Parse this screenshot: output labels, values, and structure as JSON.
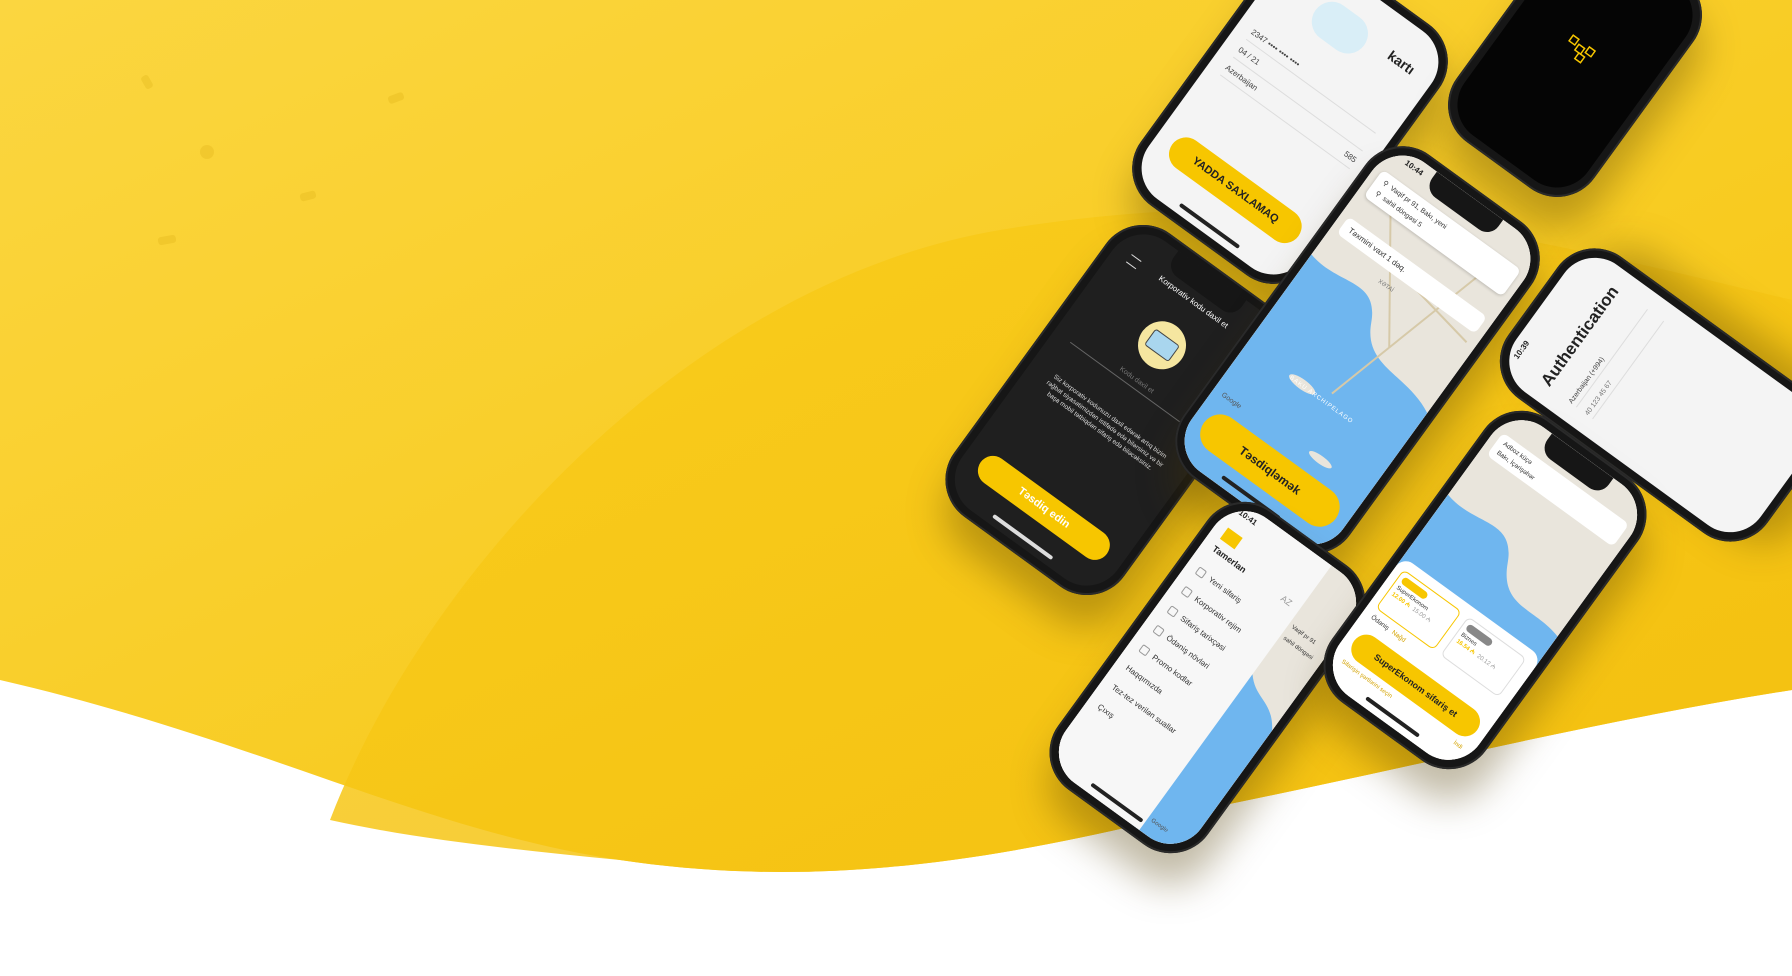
{
  "colors": {
    "brand_yellow": "#f7c600",
    "light_yellow": "#fbd63c",
    "dark_screen": "#1f1f1f",
    "map_water": "#6fb6ef",
    "map_land": "#e9e5dc"
  },
  "card_screen": {
    "title": "kartı",
    "card_number": "2347 •••• •••• ••••",
    "expiry": "04 / 21",
    "country": "Azerbaijan",
    "cvv": "585",
    "button": "YADDA SAXLAMAQ"
  },
  "logo_screen": {
    "icon": "taxi-checker-logo-icon"
  },
  "corporate_screen": {
    "title": "Korporativ kodu daxil et",
    "input_placeholder": "Kodu daxil et",
    "description": "Siz korporativ kodunuzu daxil edərək artıq bizim rəğbət siyasətimizdən istifadə edə bilərsiniz və bir başa mobil tətbiqdən sifariş edə biləcəksiniz.",
    "button": "Təsdiq edin",
    "illustration": "briefcase-icon"
  },
  "map_screen": {
    "status_time": "10:44",
    "from": "Vaqif pr 91, Bakı, yeni",
    "to": "sahil döngəsi 5",
    "eta": "Təxmini vaxt 1 dəq.",
    "map_label_area": "XƏTAİ",
    "map_label_sea": "BAKU ARCHIPELAGO",
    "button": "Təsdiqləmək",
    "google": "Google"
  },
  "auth_screen": {
    "status_time": "10:39",
    "title": "Authentication",
    "country": "Azerbaijan (+994)",
    "phone": "40 123 45 67"
  },
  "menu_screen": {
    "status_time": "10:41",
    "user": "Tamerlan",
    "lang": "AZ",
    "items": [
      "Yeni sifariş",
      "Korporativ rejim",
      "Sifariş tarixçəsi",
      "Ödəniş növləri",
      "Promo kodlar",
      "Haqqımızda",
      "Tez-tez verilən suallar",
      "Çıxış"
    ],
    "map_from": "Vaqif pr 91",
    "map_to": "sahil döngəsi",
    "google": "Google"
  },
  "order_screen": {
    "from": "Adboz küçə",
    "to": "Bakı, İçərişəhər",
    "tariff_1_name": "SuperEkonom",
    "tariff_1_price": "12.00 ₼",
    "tariff_1_old_price": "15.00 ₼",
    "tariff_2_name": "Biznes",
    "tariff_2_price": "16.54 ₼",
    "tariff_2_old_price": "20.12 ₼",
    "payment": "Ödəniş",
    "payment_type": "Nağd",
    "button": "SuperEkonom sifariş et",
    "later": "İndi",
    "link": "Sifarişin şərtlərini seçin"
  }
}
